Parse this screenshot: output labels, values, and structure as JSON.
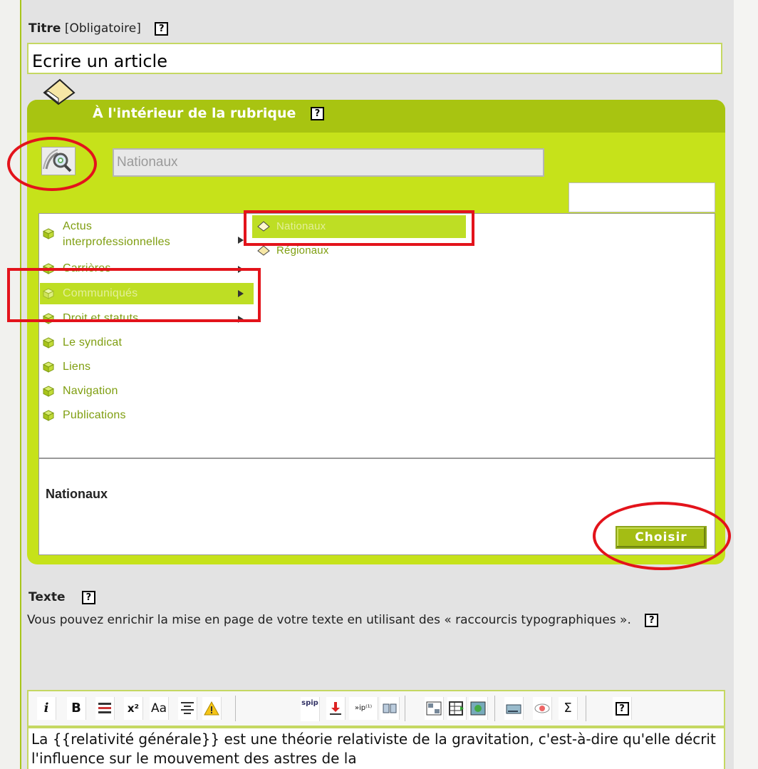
{
  "title_field": {
    "label": "Titre",
    "hint": "[Obligatoire]",
    "value": "Ecrire un article"
  },
  "help_glyph": "?",
  "rubrique": {
    "heading": "À l'intérieur de la rubrique",
    "search_value": "Nationaux",
    "tree_col1": [
      {
        "label_line1": "Actus",
        "label_line2": "interprofessionnelles",
        "has_children": true
      },
      {
        "label": "Carrières",
        "has_children": true
      },
      {
        "label": "Communiqués",
        "has_children": true,
        "selected": true
      },
      {
        "label": "Droit et statuts",
        "has_children": true
      },
      {
        "label": "Le syndicat"
      },
      {
        "label": "Liens"
      },
      {
        "label": "Navigation"
      },
      {
        "label": "Publications"
      }
    ],
    "tree_col2": [
      {
        "label": "Nationaux",
        "selected": true
      },
      {
        "label": "Régionaux"
      }
    ],
    "selected_name": "Nationaux",
    "choose_button": "Choisir"
  },
  "texte": {
    "label": "Texte",
    "description": "Vous pouvez enrichir la mise en page de votre texte en utilisant des « raccourcis typographiques ».",
    "toolbar": [
      "italic-icon",
      "bold-icon",
      "heading-icon",
      "superscript-icon",
      "font-size-icon",
      "center-align-icon",
      "warning-icon",
      "spip-icon",
      "download-icon",
      "footnote-icon",
      "glossary-icon",
      "table-icon",
      "grid-table-icon",
      "image-icon",
      "keyboard-icon",
      "preview-icon",
      "sigma-icon",
      "help-icon"
    ],
    "toolbar_labels": {
      "italic": "i",
      "bold": "B",
      "superscript": "x²",
      "fontsize": "Aa",
      "footnote": "»ip⁽¹⁾",
      "spip": "spip",
      "sigma": "Σ"
    },
    "content": "La {{relativité générale}} est une théorie relativiste de la gravitation, c'est-à-dire qu'elle décrit l'influence sur le mouvement des astres de la"
  },
  "colors": {
    "accent_dark": "#a8c411",
    "accent_light": "#c6e21a",
    "item_text": "#7f9e10",
    "annotation_red": "#e3131b"
  }
}
